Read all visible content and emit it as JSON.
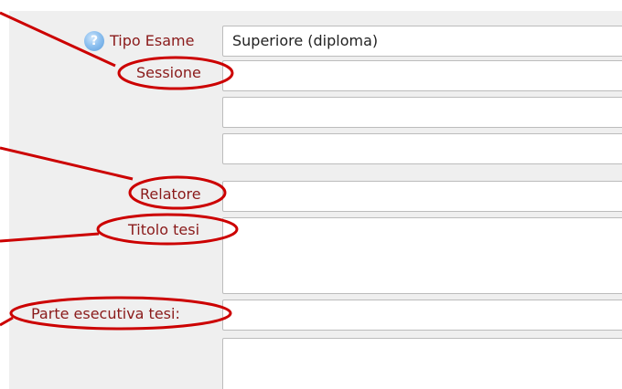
{
  "form": {
    "tipo_esame": {
      "label": "Tipo Esame",
      "value": "Superiore (diploma)"
    },
    "sessione": {
      "label": "Sessione",
      "value": ""
    },
    "relatore": {
      "label": "Relatore",
      "value": ""
    },
    "titolo_tesi": {
      "label": "Titolo tesi",
      "value": ""
    },
    "parte_esecutiva": {
      "label": "Parte esecutiva tesi:",
      "value": ""
    }
  },
  "help_icon": {
    "glyph": "?",
    "icon": "help-icon"
  },
  "annotation_color": "#cc0000",
  "label_color": "#8a1a1a"
}
